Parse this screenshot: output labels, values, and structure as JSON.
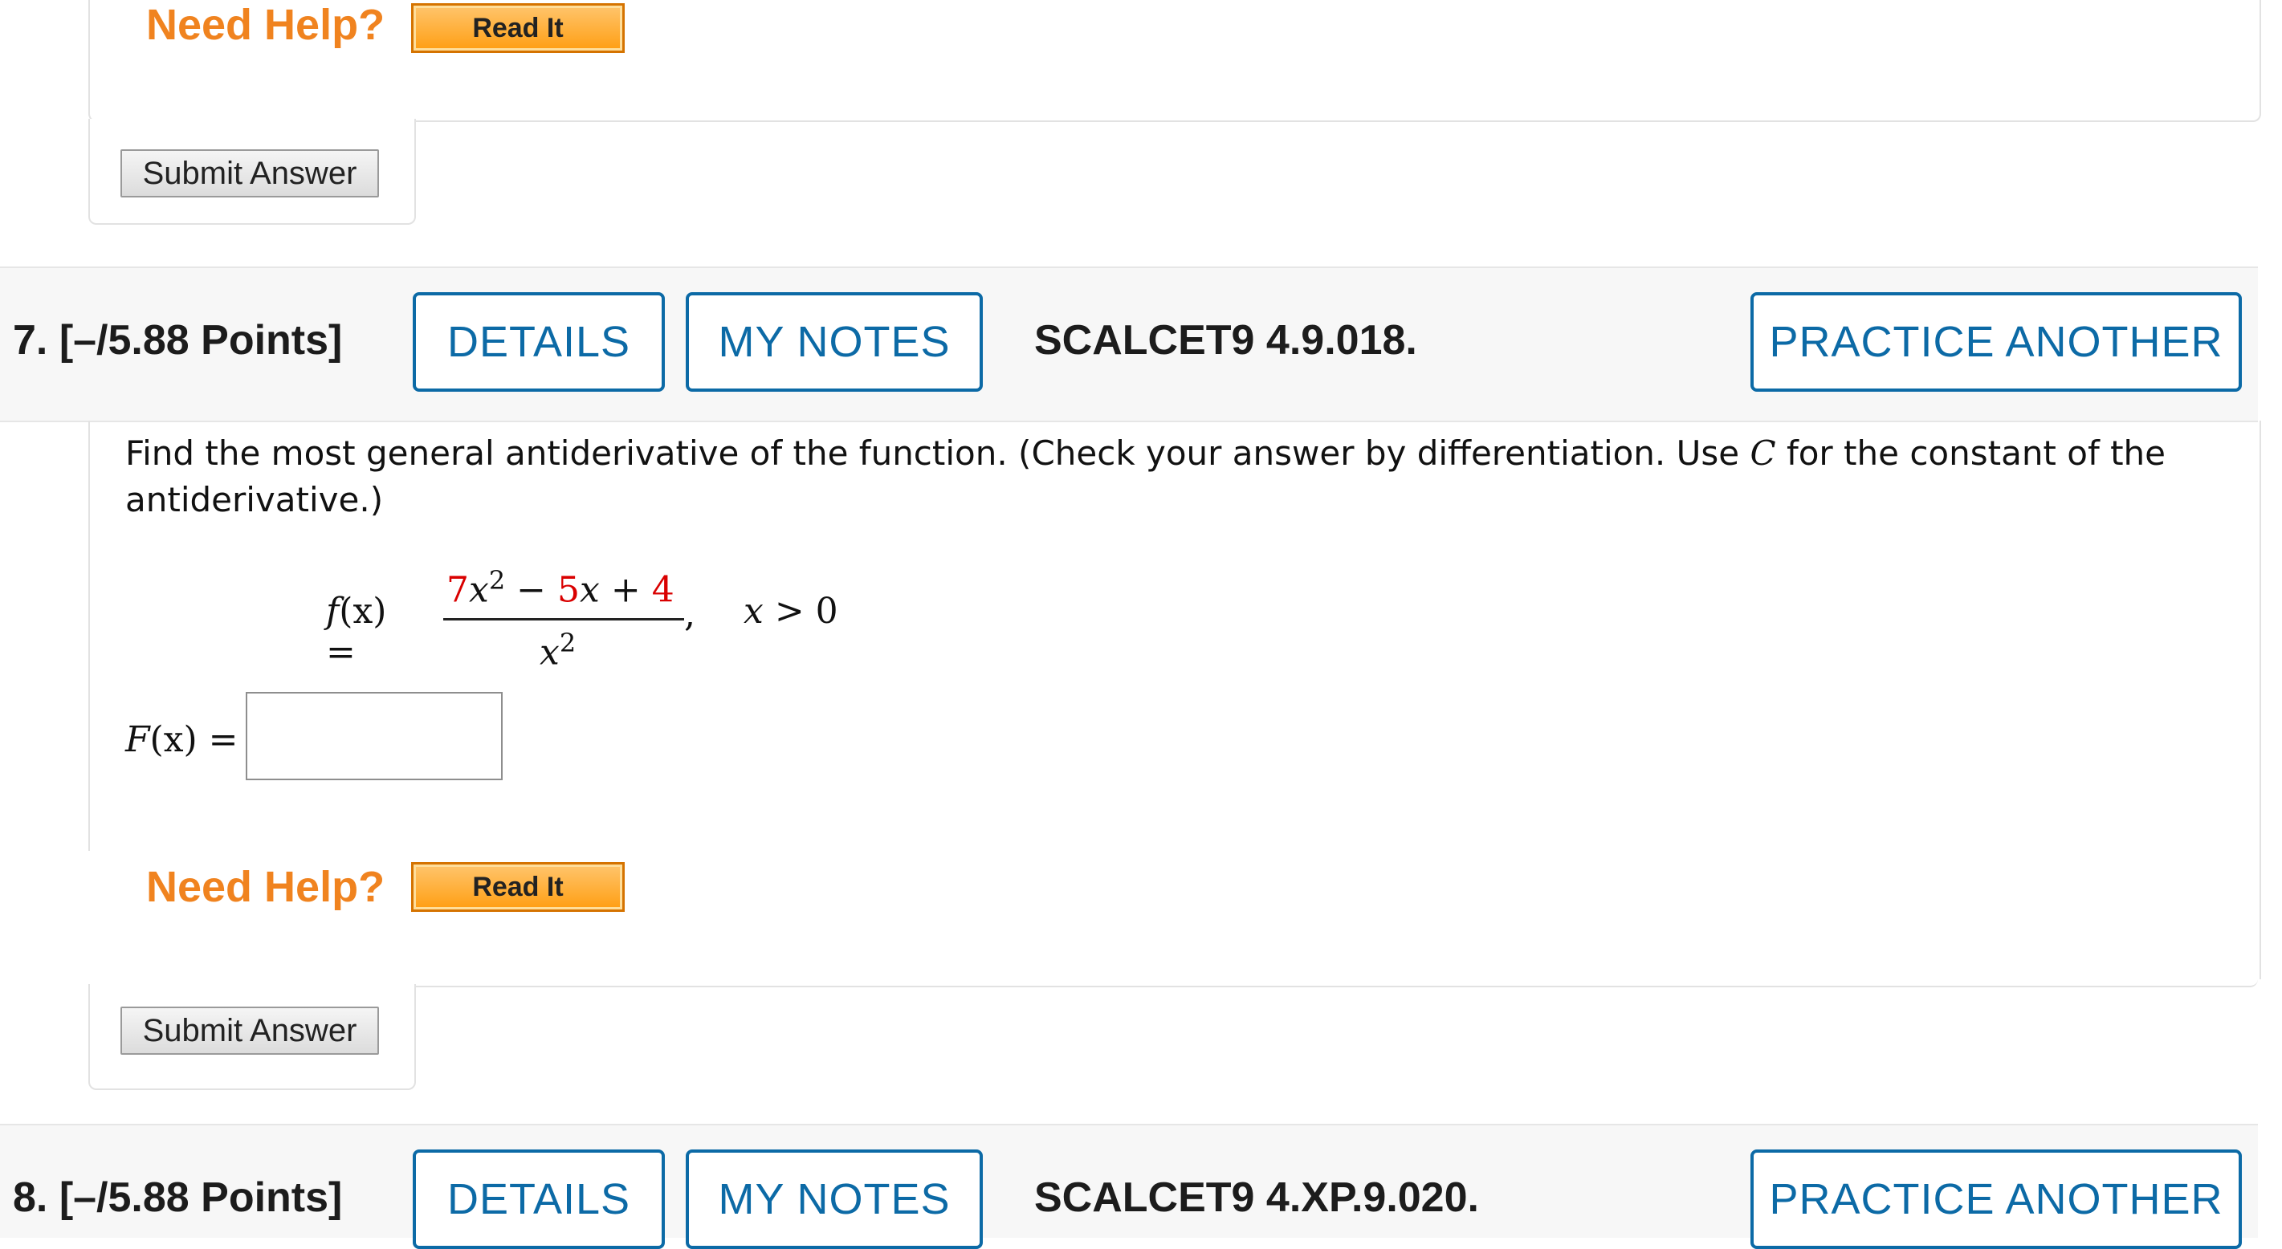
{
  "colors": {
    "accent_blue": "#0c6aa6",
    "need_help_orange": "#f0831f",
    "read_it_orange": "#ff9e12",
    "coefficient_red": "#d90000"
  },
  "prev_question": {
    "need_help": "Need Help?",
    "read_it": "Read It",
    "submit": "Submit Answer"
  },
  "q7": {
    "label": "7.  [–/5.88 Points]",
    "details": "DETAILS",
    "my_notes": "MY NOTES",
    "reference": "SCALCET9 4.9.018.",
    "practice": "PRACTICE ANOTHER",
    "prompt_before_c": "Find the most general antiderivative of the function. (Check your answer by differentiation. Use ",
    "prompt_c": "C",
    "prompt_after_c": " for the constant of the antiderivative.)",
    "function": {
      "lhs_f": "f",
      "lhs_rest": "(x) =",
      "num_a": "7",
      "num_x2": "x",
      "num_sup": "2",
      "num_minus": " − ",
      "num_b": "5",
      "num_x": "x",
      "num_plus": " + ",
      "num_c": "4",
      "den_x": "x",
      "den_sup": "2",
      "comma": ",",
      "cond_x": "x",
      "cond_rest": " > 0"
    },
    "answer_label_F": "F",
    "answer_label_rest": "(x) =",
    "answer_value": "",
    "need_help": "Need Help?",
    "read_it": "Read It",
    "submit": "Submit Answer"
  },
  "q8": {
    "label": "8.  [–/5.88 Points]",
    "details": "DETAILS",
    "my_notes": "MY NOTES",
    "reference": "SCALCET9 4.XP.9.020.",
    "practice": "PRACTICE ANOTHER"
  }
}
